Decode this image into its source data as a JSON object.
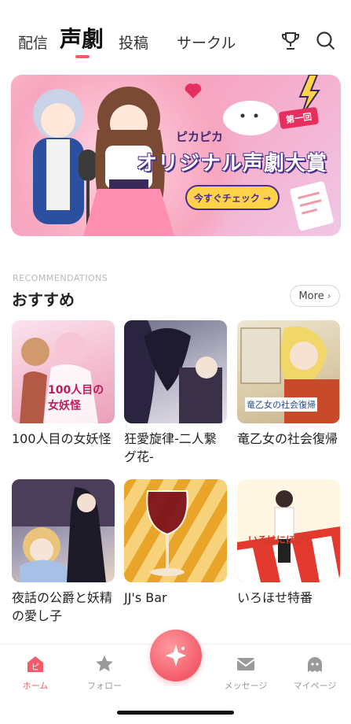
{
  "topnav": {
    "tabs": [
      {
        "label": "配信"
      },
      {
        "label": "声劇"
      },
      {
        "label": "投稿"
      },
      {
        "label": "サークル"
      }
    ],
    "active_tab": "声劇"
  },
  "banner": {
    "badge": "第一回",
    "title_top": "ピカピカ",
    "title_main": "オリジナル声劇大賞",
    "cta": "今すぐチェック →"
  },
  "section": {
    "subtitle": "RECOMMENDATIONS",
    "title": "おすすめ",
    "more_label": "More"
  },
  "cards": [
    {
      "title": "100人目の女妖怪",
      "thumb_text": "100人目の女妖怪"
    },
    {
      "title": "狂愛旋律-二人繋グ花-",
      "thumb_text": ""
    },
    {
      "title": "竜乙女の社会復帰",
      "thumb_text": "竜乙女の社会復帰"
    },
    {
      "title": "夜話の公爵と妖精の愛し子",
      "thumb_text": ""
    },
    {
      "title": "JJ's Bar",
      "thumb_text": ""
    },
    {
      "title": "いろほせ特番",
      "thumb_text": "いろはにほせと"
    }
  ],
  "bottom_nav": {
    "items": [
      {
        "label": "ホーム"
      },
      {
        "label": "フォロー"
      },
      {
        "label": "メッセージ"
      },
      {
        "label": "マイページ"
      }
    ]
  },
  "colors": {
    "accent": "#f25c6a",
    "inactive": "#9a9a9a"
  }
}
